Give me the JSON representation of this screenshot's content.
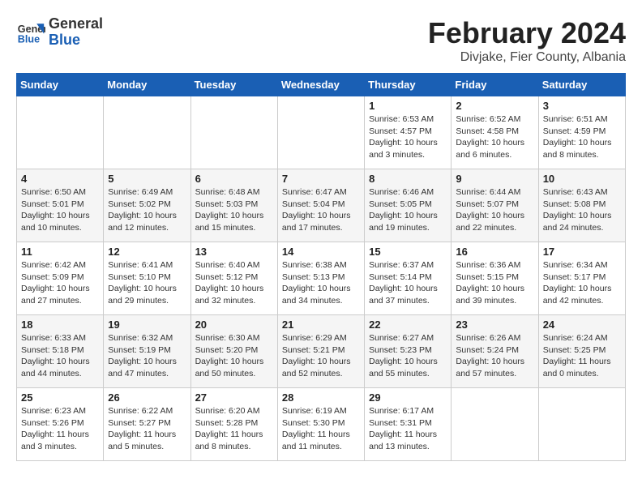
{
  "header": {
    "logo_general": "General",
    "logo_blue": "Blue",
    "month_title": "February 2024",
    "subtitle": "Divjake, Fier County, Albania"
  },
  "weekdays": [
    "Sunday",
    "Monday",
    "Tuesday",
    "Wednesday",
    "Thursday",
    "Friday",
    "Saturday"
  ],
  "weeks": [
    [
      {
        "day": "",
        "info": ""
      },
      {
        "day": "",
        "info": ""
      },
      {
        "day": "",
        "info": ""
      },
      {
        "day": "",
        "info": ""
      },
      {
        "day": "1",
        "info": "Sunrise: 6:53 AM\nSunset: 4:57 PM\nDaylight: 10 hours\nand 3 minutes."
      },
      {
        "day": "2",
        "info": "Sunrise: 6:52 AM\nSunset: 4:58 PM\nDaylight: 10 hours\nand 6 minutes."
      },
      {
        "day": "3",
        "info": "Sunrise: 6:51 AM\nSunset: 4:59 PM\nDaylight: 10 hours\nand 8 minutes."
      }
    ],
    [
      {
        "day": "4",
        "info": "Sunrise: 6:50 AM\nSunset: 5:01 PM\nDaylight: 10 hours\nand 10 minutes."
      },
      {
        "day": "5",
        "info": "Sunrise: 6:49 AM\nSunset: 5:02 PM\nDaylight: 10 hours\nand 12 minutes."
      },
      {
        "day": "6",
        "info": "Sunrise: 6:48 AM\nSunset: 5:03 PM\nDaylight: 10 hours\nand 15 minutes."
      },
      {
        "day": "7",
        "info": "Sunrise: 6:47 AM\nSunset: 5:04 PM\nDaylight: 10 hours\nand 17 minutes."
      },
      {
        "day": "8",
        "info": "Sunrise: 6:46 AM\nSunset: 5:05 PM\nDaylight: 10 hours\nand 19 minutes."
      },
      {
        "day": "9",
        "info": "Sunrise: 6:44 AM\nSunset: 5:07 PM\nDaylight: 10 hours\nand 22 minutes."
      },
      {
        "day": "10",
        "info": "Sunrise: 6:43 AM\nSunset: 5:08 PM\nDaylight: 10 hours\nand 24 minutes."
      }
    ],
    [
      {
        "day": "11",
        "info": "Sunrise: 6:42 AM\nSunset: 5:09 PM\nDaylight: 10 hours\nand 27 minutes."
      },
      {
        "day": "12",
        "info": "Sunrise: 6:41 AM\nSunset: 5:10 PM\nDaylight: 10 hours\nand 29 minutes."
      },
      {
        "day": "13",
        "info": "Sunrise: 6:40 AM\nSunset: 5:12 PM\nDaylight: 10 hours\nand 32 minutes."
      },
      {
        "day": "14",
        "info": "Sunrise: 6:38 AM\nSunset: 5:13 PM\nDaylight: 10 hours\nand 34 minutes."
      },
      {
        "day": "15",
        "info": "Sunrise: 6:37 AM\nSunset: 5:14 PM\nDaylight: 10 hours\nand 37 minutes."
      },
      {
        "day": "16",
        "info": "Sunrise: 6:36 AM\nSunset: 5:15 PM\nDaylight: 10 hours\nand 39 minutes."
      },
      {
        "day": "17",
        "info": "Sunrise: 6:34 AM\nSunset: 5:17 PM\nDaylight: 10 hours\nand 42 minutes."
      }
    ],
    [
      {
        "day": "18",
        "info": "Sunrise: 6:33 AM\nSunset: 5:18 PM\nDaylight: 10 hours\nand 44 minutes."
      },
      {
        "day": "19",
        "info": "Sunrise: 6:32 AM\nSunset: 5:19 PM\nDaylight: 10 hours\nand 47 minutes."
      },
      {
        "day": "20",
        "info": "Sunrise: 6:30 AM\nSunset: 5:20 PM\nDaylight: 10 hours\nand 50 minutes."
      },
      {
        "day": "21",
        "info": "Sunrise: 6:29 AM\nSunset: 5:21 PM\nDaylight: 10 hours\nand 52 minutes."
      },
      {
        "day": "22",
        "info": "Sunrise: 6:27 AM\nSunset: 5:23 PM\nDaylight: 10 hours\nand 55 minutes."
      },
      {
        "day": "23",
        "info": "Sunrise: 6:26 AM\nSunset: 5:24 PM\nDaylight: 10 hours\nand 57 minutes."
      },
      {
        "day": "24",
        "info": "Sunrise: 6:24 AM\nSunset: 5:25 PM\nDaylight: 11 hours\nand 0 minutes."
      }
    ],
    [
      {
        "day": "25",
        "info": "Sunrise: 6:23 AM\nSunset: 5:26 PM\nDaylight: 11 hours\nand 3 minutes."
      },
      {
        "day": "26",
        "info": "Sunrise: 6:22 AM\nSunset: 5:27 PM\nDaylight: 11 hours\nand 5 minutes."
      },
      {
        "day": "27",
        "info": "Sunrise: 6:20 AM\nSunset: 5:28 PM\nDaylight: 11 hours\nand 8 minutes."
      },
      {
        "day": "28",
        "info": "Sunrise: 6:19 AM\nSunset: 5:30 PM\nDaylight: 11 hours\nand 11 minutes."
      },
      {
        "day": "29",
        "info": "Sunrise: 6:17 AM\nSunset: 5:31 PM\nDaylight: 11 hours\nand 13 minutes."
      },
      {
        "day": "",
        "info": ""
      },
      {
        "day": "",
        "info": ""
      }
    ]
  ]
}
